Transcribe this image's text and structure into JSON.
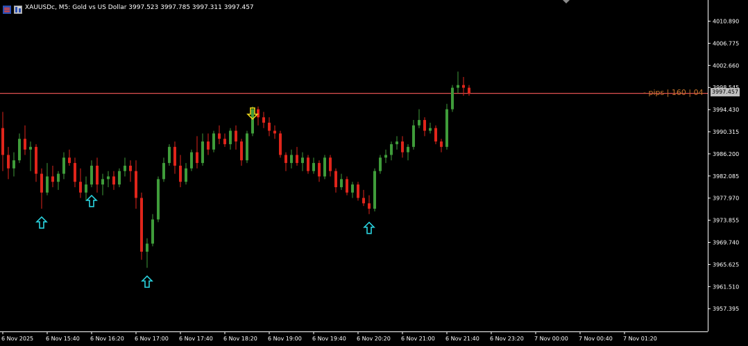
{
  "header": {
    "symbol_text": "XAUUSDc, M5:  Gold vs US Dollar  3997.523 3997.785 3997.311 3997.457"
  },
  "current_price_tag": "3997.457",
  "pips_label": "- pips | 160 | 04",
  "colors": {
    "background": "#000000",
    "bull": "#3f9c3a",
    "bear": "#e0251b",
    "grid_text": "#ffffff",
    "axis": "#ffffff",
    "price_line": "#e05050",
    "buy_arrow": "#2ad4e0",
    "sell_arrow": "#e8d21a",
    "pips_text": "#c8762c"
  },
  "chart_data": {
    "type": "candlestick",
    "timeframe": "M5",
    "ylim": [
      3955.0,
      4014.0
    ],
    "y_ticks": [
      "4010.890",
      "4006.775",
      "4002.660",
      "3998.545",
      "3994.430",
      "3990.315",
      "3986.200",
      "3982.085",
      "3977.970",
      "3973.855",
      "3969.740",
      "3965.625",
      "3961.510",
      "3957.395"
    ],
    "x_ticks": [
      "6 Nov 2025",
      "6 Nov 15:40",
      "6 Nov 16:20",
      "6 Nov 17:00",
      "6 Nov 17:40",
      "6 Nov 18:20",
      "6 Nov 19:00",
      "6 Nov 19:40",
      "6 Nov 20:20",
      "6 Nov 21:00",
      "6 Nov 21:40",
      "6 Nov 23:20",
      "7 Nov 00:00",
      "7 Nov 00:40",
      "7 Nov 01:20"
    ],
    "x_tick_index": [
      0,
      8,
      16,
      24,
      32,
      40,
      48,
      56,
      64,
      72,
      80,
      88,
      96,
      104,
      112
    ],
    "current_price": 3997.457,
    "candles": [
      [
        3991.0,
        3994.0,
        3983.0,
        3986.0
      ],
      [
        3986.0,
        3987.5,
        3981.5,
        3983.5
      ],
      [
        3983.5,
        3986.5,
        3982.0,
        3985.0
      ],
      [
        3985.0,
        3990.0,
        3984.5,
        3989.0
      ],
      [
        3989.0,
        3991.5,
        3986.0,
        3987.0
      ],
      [
        3987.0,
        3988.5,
        3983.0,
        3987.5
      ],
      [
        3987.5,
        3988.0,
        3981.0,
        3982.5
      ],
      [
        3982.5,
        3983.5,
        3976.0,
        3979.0
      ],
      [
        3979.0,
        3984.5,
        3978.5,
        3982.0
      ],
      [
        3982.0,
        3984.0,
        3980.0,
        3981.0
      ],
      [
        3981.0,
        3983.0,
        3979.5,
        3982.5
      ],
      [
        3982.5,
        3986.5,
        3981.5,
        3985.5
      ],
      [
        3985.5,
        3987.0,
        3984.0,
        3984.5
      ],
      [
        3984.5,
        3985.5,
        3980.0,
        3981.0
      ],
      [
        3981.0,
        3983.5,
        3978.0,
        3979.0
      ],
      [
        3979.0,
        3982.0,
        3977.5,
        3980.5
      ],
      [
        3980.5,
        3985.0,
        3980.0,
        3984.0
      ],
      [
        3984.0,
        3985.5,
        3979.0,
        3980.5
      ],
      [
        3980.5,
        3982.5,
        3978.5,
        3981.5
      ],
      [
        3981.5,
        3983.0,
        3980.0,
        3982.0
      ],
      [
        3982.0,
        3983.0,
        3979.5,
        3980.5
      ],
      [
        3980.5,
        3983.5,
        3980.0,
        3983.0
      ],
      [
        3983.0,
        3985.5,
        3982.0,
        3984.0
      ],
      [
        3984.0,
        3985.0,
        3981.0,
        3983.0
      ],
      [
        3983.0,
        3985.0,
        3976.0,
        3978.0
      ],
      [
        3978.0,
        3979.0,
        3966.5,
        3968.0
      ],
      [
        3968.0,
        3970.5,
        3965.0,
        3969.5
      ],
      [
        3969.5,
        3975.0,
        3969.0,
        3974.0
      ],
      [
        3974.0,
        3982.0,
        3973.5,
        3981.5
      ],
      [
        3981.5,
        3985.5,
        3981.0,
        3984.5
      ],
      [
        3984.5,
        3988.0,
        3984.0,
        3987.5
      ],
      [
        3987.5,
        3988.5,
        3982.5,
        3984.0
      ],
      [
        3984.0,
        3986.0,
        3980.0,
        3981.0
      ],
      [
        3981.0,
        3984.5,
        3980.5,
        3983.5
      ],
      [
        3983.5,
        3987.0,
        3983.0,
        3986.5
      ],
      [
        3986.5,
        3989.5,
        3983.5,
        3984.5
      ],
      [
        3984.5,
        3990.0,
        3984.0,
        3988.5
      ],
      [
        3988.5,
        3990.0,
        3986.0,
        3987.0
      ],
      [
        3987.0,
        3990.5,
        3986.5,
        3990.0
      ],
      [
        3990.0,
        3991.5,
        3988.0,
        3989.0
      ],
      [
        3989.0,
        3990.0,
        3987.5,
        3988.0
      ],
      [
        3988.0,
        3991.0,
        3987.0,
        3990.5
      ],
      [
        3990.5,
        3991.5,
        3987.0,
        3988.5
      ],
      [
        3988.5,
        3989.0,
        3984.0,
        3985.0
      ],
      [
        3985.0,
        3990.5,
        3984.5,
        3990.0
      ],
      [
        3990.0,
        3995.0,
        3989.5,
        3994.5
      ],
      [
        3994.5,
        3995.0,
        3991.5,
        3993.0
      ],
      [
        3993.0,
        3994.0,
        3991.0,
        3992.0
      ],
      [
        3992.0,
        3993.0,
        3989.5,
        3990.5
      ],
      [
        3990.5,
        3991.5,
        3989.0,
        3990.0
      ],
      [
        3990.0,
        3990.5,
        3985.5,
        3986.0
      ],
      [
        3986.0,
        3986.5,
        3983.0,
        3984.5
      ],
      [
        3984.5,
        3987.0,
        3983.5,
        3986.0
      ],
      [
        3986.0,
        3987.5,
        3984.0,
        3984.5
      ],
      [
        3984.5,
        3986.5,
        3983.0,
        3985.5
      ],
      [
        3985.5,
        3986.0,
        3982.5,
        3983.0
      ],
      [
        3983.0,
        3985.5,
        3982.5,
        3984.5
      ],
      [
        3984.5,
        3985.0,
        3981.0,
        3982.0
      ],
      [
        3982.0,
        3986.0,
        3981.5,
        3985.5
      ],
      [
        3985.5,
        3986.0,
        3982.0,
        3983.0
      ],
      [
        3983.0,
        3983.5,
        3979.0,
        3980.0
      ],
      [
        3980.0,
        3982.5,
        3979.5,
        3981.5
      ],
      [
        3981.5,
        3982.0,
        3978.5,
        3979.0
      ],
      [
        3979.0,
        3981.0,
        3978.0,
        3980.5
      ],
      [
        3980.5,
        3981.0,
        3977.5,
        3978.0
      ],
      [
        3978.0,
        3979.5,
        3976.5,
        3977.0
      ],
      [
        3977.0,
        3978.5,
        3975.0,
        3976.0
      ],
      [
        3976.0,
        3983.5,
        3975.5,
        3983.0
      ],
      [
        3983.0,
        3986.0,
        3982.5,
        3985.5
      ],
      [
        3985.5,
        3987.0,
        3984.5,
        3986.0
      ],
      [
        3986.0,
        3988.5,
        3985.0,
        3988.0
      ],
      [
        3988.0,
        3989.5,
        3987.0,
        3988.5
      ],
      [
        3988.5,
        3989.5,
        3985.5,
        3986.5
      ],
      [
        3986.5,
        3988.0,
        3985.0,
        3987.5
      ],
      [
        3987.5,
        3992.5,
        3987.0,
        3991.5
      ],
      [
        3991.5,
        3994.5,
        3991.0,
        3992.5
      ],
      [
        3992.5,
        3993.0,
        3989.5,
        3990.5
      ],
      [
        3990.5,
        3992.0,
        3990.0,
        3991.0
      ],
      [
        3991.0,
        3991.5,
        3988.0,
        3988.5
      ],
      [
        3988.5,
        3989.0,
        3986.5,
        3987.5
      ],
      [
        3987.5,
        3995.5,
        3987.0,
        3994.5
      ],
      [
        3994.5,
        3999.0,
        3994.0,
        3998.5
      ],
      [
        3998.5,
        4001.5,
        3997.5,
        3999.0
      ],
      [
        3999.0,
        4000.5,
        3997.0,
        3998.5
      ],
      [
        3998.5,
        3999.0,
        3997.0,
        3997.457
      ]
    ],
    "buy_arrows": [
      7,
      16,
      26,
      66
    ],
    "sell_arrows": [
      45
    ]
  }
}
